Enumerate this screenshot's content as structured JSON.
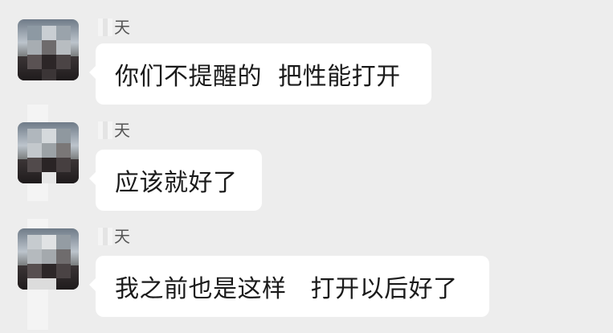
{
  "messages": [
    {
      "sender": "天",
      "text": "你们不提醒的  把性能打开"
    },
    {
      "sender": "天",
      "text": "应该就好了"
    },
    {
      "sender": "天",
      "text": "我之前也是这样   打开以后好了"
    }
  ]
}
